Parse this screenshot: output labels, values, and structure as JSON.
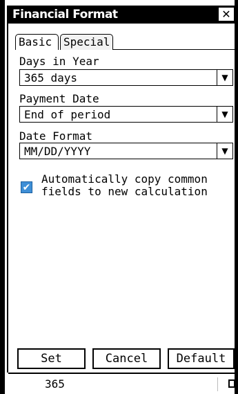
{
  "window": {
    "title": "Financial Format",
    "close_glyph": "✕"
  },
  "tabs": [
    {
      "label": "Basic",
      "active": true
    },
    {
      "label": "Special",
      "active": false
    }
  ],
  "fields": {
    "days_in_year": {
      "label": "Days in Year",
      "value": "365 days"
    },
    "payment_date": {
      "label": "Payment Date",
      "value": "End of period"
    },
    "date_format": {
      "label": "Date Format",
      "value": "MM/DD/YYYY"
    }
  },
  "dropdown_arrow": "▼",
  "checkbox": {
    "checked": true,
    "check_glyph": "✔",
    "label": "Automatically copy common fields to new calculation"
  },
  "buttons": {
    "set": "Set",
    "cancel": "Cancel",
    "default": "Default"
  },
  "status": {
    "value": "365",
    "battery_icon": "battery-icon"
  },
  "colors": {
    "titlebar": "#000000",
    "checkbox": "#3f8fd6"
  }
}
